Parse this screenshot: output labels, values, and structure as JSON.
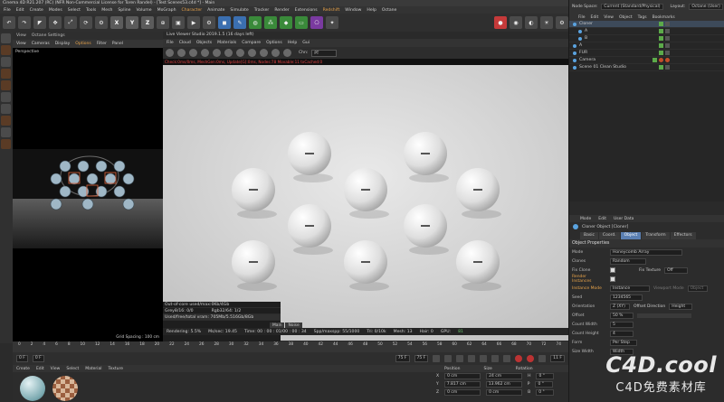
{
  "window": {
    "title": "Cinema 4D R21.207 (RC) (NFR Non-Commercial License for Toren Randel) - [Test Scenes53.c4d *] - Main"
  },
  "menubar": [
    "File",
    "Edit",
    "Create",
    "Modes",
    "Select",
    "Tools",
    "Mesh",
    "Spline",
    "Volume",
    "MoGraph",
    "Character",
    "Animate",
    "Simulate",
    "Tracker",
    "Render",
    "Extensions",
    "Redshift",
    "Window",
    "Help",
    "Octane"
  ],
  "toolbar": {
    "axis_buttons": [
      "X",
      "Y",
      "Z"
    ]
  },
  "viewport": {
    "tabs": [
      "View",
      "Octane Settings"
    ],
    "menu": [
      "View",
      "Cameras",
      "Display",
      "Options",
      "Filter",
      "Panel"
    ],
    "active_menu": "Options",
    "label": "Perspective",
    "grid_spacing": "Grid Spacing : 100 cm"
  },
  "live_viewer": {
    "title": "Live Viewer Studio 2019.1.5 (16 days left)",
    "menu": [
      "File",
      "Cloud",
      "Objects",
      "Materials",
      "Compare",
      "Options",
      "Help",
      "Gui"
    ],
    "channel_select": "PT",
    "channel_label": "Chn:",
    "info_line": "Check:0ms/0ms, MeshGen:0ms, Update[G]:0ms, Nodes:78 Movable:11 txCached:0",
    "stats": [
      "Out-of-core used/max:0Kb/4Gb",
      "Grey8/16: 0/0",
      "Rgb32/64: 1/2",
      "Used/free/total vram: 705Mb/5.516Gb/8Gb"
    ],
    "tabs": [
      "Main",
      "Noise"
    ]
  },
  "statusbar": {
    "rendering": "Rendering: 5.5%",
    "ms_sec": "Ms/sec: 19.45",
    "time": "Time: 00 : 00 : 01/00 : 00 : 34",
    "spp": "Spp/maxspp: 55/1000",
    "tri": "Tri: 0/10k",
    "mesh": "Mesh: 13",
    "hair": "Hair: 0",
    "gpu": "GPU:",
    "gpu_value": "81"
  },
  "timeline": {
    "marks": [
      "0",
      "2",
      "4",
      "6",
      "8",
      "10",
      "12",
      "14",
      "16",
      "18",
      "20",
      "22",
      "24",
      "26",
      "28",
      "30",
      "32",
      "34",
      "36",
      "38",
      "40",
      "42",
      "44",
      "46",
      "48",
      "50",
      "52",
      "54",
      "56",
      "58",
      "60",
      "62",
      "64",
      "66",
      "68",
      "70",
      "72",
      "74"
    ],
    "current_frame": "11 F",
    "start": "0 F",
    "start2": "0 F",
    "end": "75 F",
    "end2": "75 F"
  },
  "material_panel": {
    "menu": [
      "Create",
      "Edit",
      "View",
      "Select",
      "Material",
      "Texture"
    ]
  },
  "coords": {
    "headers": [
      "Position",
      "Size",
      "Rotation"
    ],
    "rows": [
      {
        "axis": "X",
        "pos": "0 cm",
        "size": "24 cm",
        "rot_label": "H",
        "rot": "0 °"
      },
      {
        "axis": "Y",
        "pos": "7.817 cm",
        "size": "13.962 cm",
        "rot_label": "P",
        "rot": "0 °"
      },
      {
        "axis": "Z",
        "pos": "0 cm",
        "size": "0 cm",
        "rot_label": "B",
        "rot": "0 °"
      }
    ]
  },
  "right_panel": {
    "node_space_label": "Node Space:",
    "node_space_value": "Current (Standard/Physical)",
    "layout_label": "Layout:",
    "layout_value": "Octane (User)",
    "menu": [
      "File",
      "Edit",
      "View",
      "Object",
      "Tags",
      "Bookmarks"
    ],
    "objects": [
      {
        "name": "Cloner",
        "selected": true
      },
      {
        "name": "A",
        "selected": false
      },
      {
        "name": "B",
        "selected": false
      },
      {
        "name": "A",
        "selected": false
      },
      {
        "name": "FUR",
        "selected": false
      },
      {
        "name": "Camera",
        "selected": false
      },
      {
        "name": "Scene 01 Clean Studio",
        "selected": false
      }
    ]
  },
  "attributes": {
    "menu": [
      "Mode",
      "Edit",
      "User Data"
    ],
    "object_title": "Cloner Object [Cloner]",
    "tabs": [
      "Basic",
      "Coord.",
      "Object",
      "Transform",
      "Effectors"
    ],
    "active_tab": "Object",
    "section": "Object Properties",
    "mode_label": "Mode",
    "mode_value": "Honeycomb Array",
    "clones_label": "Clones",
    "clones_value": "Random",
    "fix_clone_label": "Fix Clone",
    "fix_texture_label": "Fix Texture",
    "fix_texture_value": "Off",
    "render_instances_label": "Render Instances",
    "instance_mode_label": "Instance Mode",
    "instance_mode_value": "Instance",
    "viewport_mode_label": "Viewport Mode",
    "viewport_mode_value": "Object",
    "seed_label": "Seed",
    "seed_value": "1234565",
    "orientation_label": "Orientation",
    "orientation_value": "Z (XY)",
    "offset_dir_label": "Offset Direction",
    "offset_dir_value": "Height",
    "offset_label": "Offset",
    "offset_value": "50 %",
    "count_width_label": "Count Width",
    "count_width_value": "5",
    "count_height_label": "Count Height",
    "count_height_value": "4",
    "form_label": "Form",
    "form_value": "Per Step",
    "size_width_label": "Size Width",
    "size_width_value": "Width"
  },
  "watermark": {
    "title": "C4D.cool",
    "subtitle": "C4D免费素材库"
  }
}
